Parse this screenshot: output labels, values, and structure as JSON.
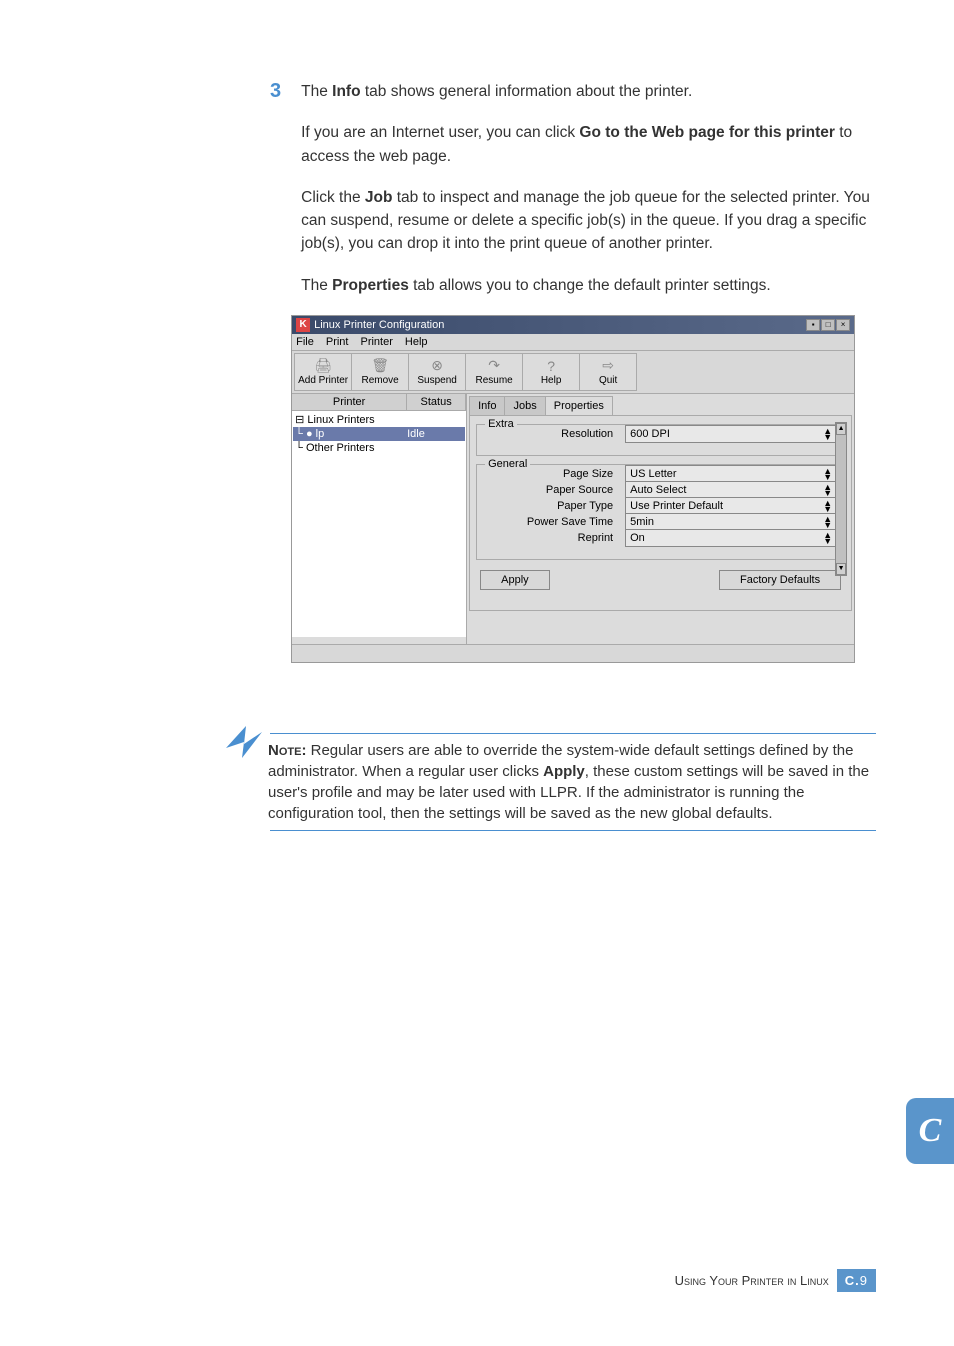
{
  "step_number": "3",
  "p1": {
    "a": "The ",
    "b": "Info",
    "c": " tab shows general information about the printer."
  },
  "p2": {
    "a": "If you are an Internet user, you can click ",
    "b": "Go to the Web page for this printer",
    "c": " to access the web page."
  },
  "p3": {
    "a": "Click the ",
    "b": "Job",
    "c": " tab to inspect and manage the job queue for the selected printer. You can suspend, resume or delete a specific job(s) in the queue. If you drag a specific job(s), you can drop it into the print queue of another printer."
  },
  "p4": {
    "a": "The ",
    "b": "Properties",
    "c": " tab allows you to change the default printer settings."
  },
  "dialog": {
    "k": "K",
    "title": "Linux Printer Configuration",
    "menus": [
      "File",
      "Print",
      "Printer",
      "Help"
    ],
    "toolbar": [
      {
        "label": "Add Printer",
        "icn": "🖨"
      },
      {
        "label": "Remove",
        "icn": "🗑"
      },
      {
        "label": "Suspend",
        "icn": "⊗"
      },
      {
        "label": "Resume",
        "icn": "↷"
      },
      {
        "label": "Help",
        "icn": "?"
      },
      {
        "label": "Quit",
        "icn": "⇨"
      }
    ],
    "list_headers": {
      "c1": "Printer",
      "c2": "Status"
    },
    "tree": [
      {
        "t1": "⊟ Linux Printers",
        "t2": "",
        "sel": false
      },
      {
        "t1": "  └ ● lp",
        "t2": "Idle",
        "sel": true
      },
      {
        "t1": "└ Other Printers",
        "t2": "",
        "sel": false
      }
    ],
    "tabs": [
      "Info",
      "Jobs",
      "Properties"
    ],
    "groups": {
      "extra": "Extra",
      "general": "General"
    },
    "rows": [
      {
        "group": "extra",
        "label": "Resolution",
        "value": "600 DPI"
      },
      {
        "group": "general",
        "label": "Page Size",
        "value": "US Letter"
      },
      {
        "group": "general",
        "label": "Paper Source",
        "value": "Auto Select"
      },
      {
        "group": "general",
        "label": "Paper Type",
        "value": "Use Printer Default"
      },
      {
        "group": "general",
        "label": "Power Save Time",
        "value": "5min"
      },
      {
        "group": "general",
        "label": "Reprint",
        "value": "On"
      }
    ],
    "buttons": {
      "apply": "Apply",
      "factory": "Factory Defaults"
    }
  },
  "note": {
    "label": "Note:",
    "text": " Regular users are able to override the system-wide default settings defined by the administrator. When a regular user clicks ",
    "apply": "Apply",
    "text2": ", these custom settings will be saved in the user's profile and may be later used with LLPR. If the administrator is running the configuration tool, then the settings will be saved as the new global defaults."
  },
  "thumb": "C",
  "footer": {
    "text": "Using Your Printer in Linux",
    "pg_prefix": "C.",
    "pg_num": "9"
  }
}
